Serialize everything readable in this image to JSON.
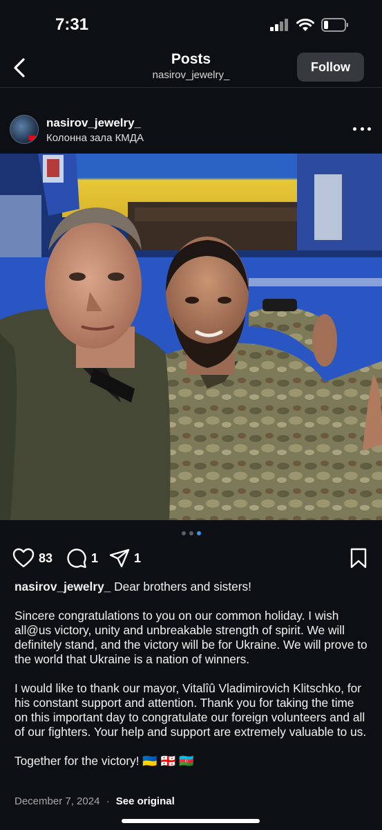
{
  "status_bar": {
    "time": "7:31"
  },
  "nav": {
    "title": "Posts",
    "subtitle": "nasirov_jewelry_",
    "follow_label": "Follow"
  },
  "post": {
    "username": "nasirov_jewelry_",
    "location": "Колонна зала КМДА",
    "carousel": {
      "total": 3,
      "active_index": 2
    },
    "likes": "83",
    "comments": "1",
    "shares": "1",
    "caption_user": "nasirov_jewelry_",
    "caption_first": "Dear brothers and sisters!",
    "caption_p2": "Sincere congratulations to you on our common holiday. I wish all@us victory, unity and unbreakable strength of spirit. We will definitely stand, and the victory will be for Ukraine. We will prove to the world that Ukraine is a nation of winners.",
    "caption_p3": "I would like to thank our mayor, Vitalîû Vladimirovich Klitschko, for his constant support and attention. Thank you for taking the time on this important day to congratulate our foreign volunteers and all of our fighters. Your help and support are extremely valuable to us.",
    "caption_p4": "Together for the victory! 🇺🇦 🇬🇪 🇦🇿",
    "date": "December 7, 2024",
    "separator": "·",
    "see_original": "See original"
  },
  "colors": {
    "background": "#0c1014",
    "follow_bg": "#363a3f",
    "active_dot": "#3897f0"
  }
}
